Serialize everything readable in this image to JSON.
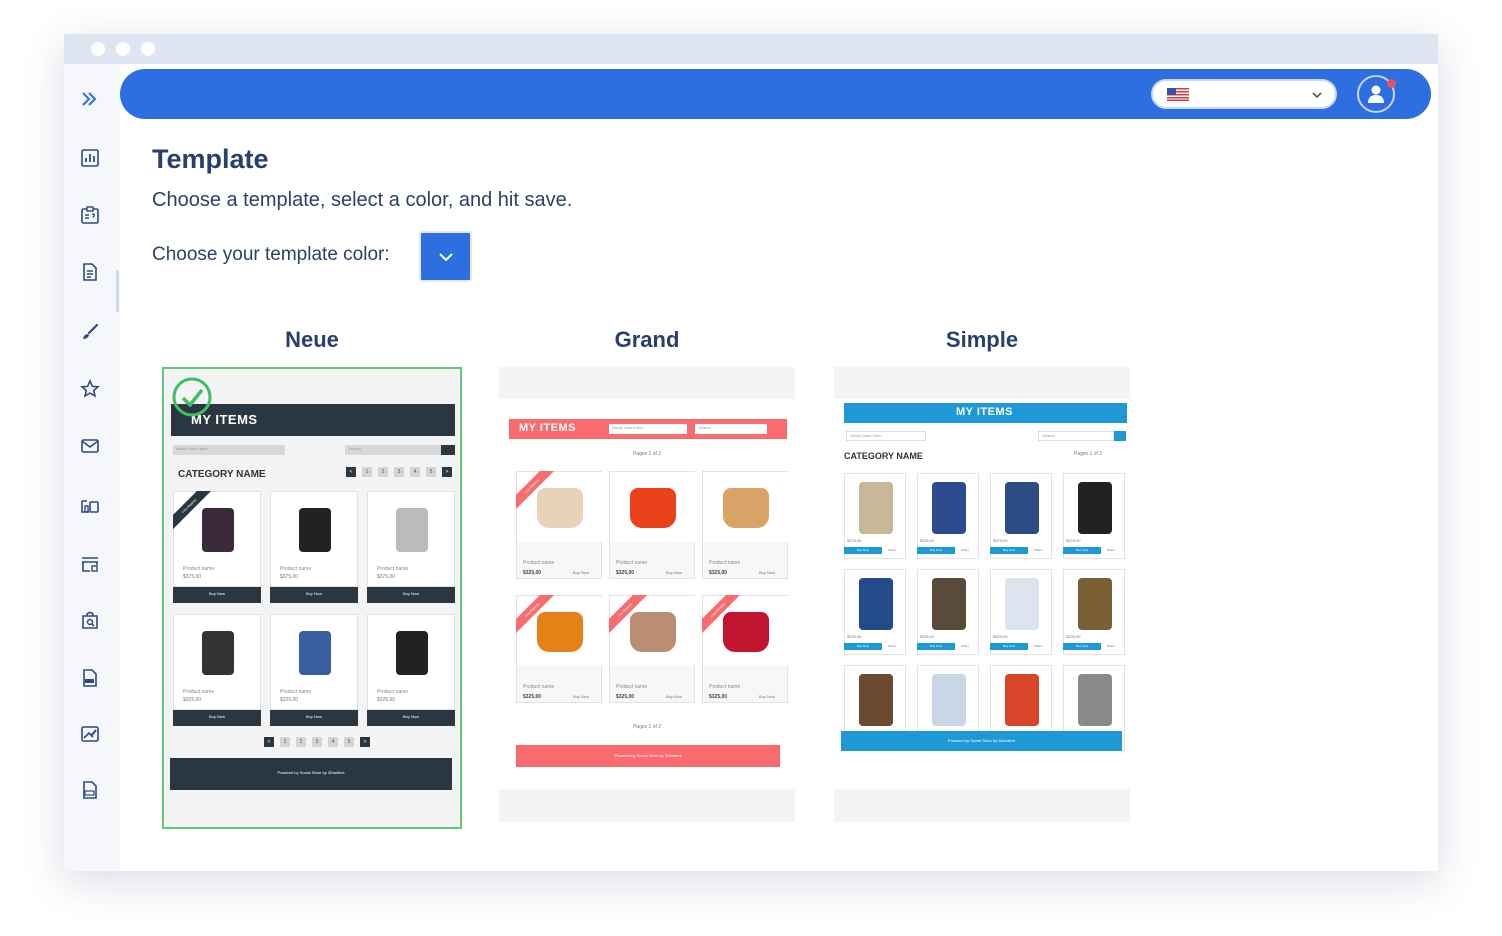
{
  "page": {
    "title": "Template",
    "subtitle": "Choose a template, select a color, and hit save.",
    "color_label": "Choose your template color:"
  },
  "header": {
    "language_icon": "us-flag-icon",
    "selected_language": "",
    "accent_color": "#2d6fe0",
    "notification_color": "#ef4f5c"
  },
  "sidebar": {
    "items": [
      {
        "icon": "expand-double-chevron-icon"
      },
      {
        "icon": "bar-chart-icon"
      },
      {
        "icon": "clipboard-question-icon"
      },
      {
        "icon": "document-icon"
      },
      {
        "icon": "brush-icon"
      },
      {
        "icon": "star-icon"
      },
      {
        "icon": "mail-icon"
      },
      {
        "icon": "devices-icon"
      },
      {
        "icon": "store-icon"
      },
      {
        "icon": "bag-search-icon"
      },
      {
        "icon": "pdf-file-icon"
      },
      {
        "icon": "image-edit-icon"
      },
      {
        "icon": "csv-file-icon"
      }
    ]
  },
  "templates": [
    {
      "name": "Neue",
      "selected": true,
      "preview": {
        "title": "MY ITEMS",
        "filter": "Newly Listed Item",
        "search": "Search",
        "category": "CATEGORY NAME",
        "products": [
          {
            "name": "Product name",
            "price": "$375,00",
            "buy": "Buy Now"
          },
          {
            "name": "Product name",
            "price": "$375,00",
            "buy": "Buy Now"
          },
          {
            "name": "Product name",
            "price": "$375,00",
            "buy": "Buy Now"
          },
          {
            "name": "Product name",
            "price": "$325,00",
            "buy": "Buy Now"
          },
          {
            "name": "Product name",
            "price": "$325,00",
            "buy": "Buy Now"
          },
          {
            "name": "Product name",
            "price": "$325,00",
            "buy": "Buy Now"
          }
        ],
        "ribbon": "Free Shipping",
        "pages": [
          "<",
          "1",
          "2",
          "3",
          "4",
          "5",
          ">"
        ],
        "footer": "Powered by Social Store by 3Dsellers",
        "color": "#2b3740"
      }
    },
    {
      "name": "Grand",
      "selected": false,
      "preview": {
        "title": "MY ITEMS",
        "filter": "Newly Listed Item",
        "search": "Search",
        "pages_label": "Pages 1 of 2",
        "products": [
          {
            "name": "Product name",
            "price": "$325,00",
            "buy": "Buy Now"
          },
          {
            "name": "Product name",
            "price": "$325,00",
            "buy": "Buy Now"
          },
          {
            "name": "Product name",
            "price": "$325,00",
            "buy": "Buy Now"
          },
          {
            "name": "Product name",
            "price": "$325,00",
            "buy": "Buy Now"
          },
          {
            "name": "Product name",
            "price": "$325,00",
            "buy": "Buy Now"
          },
          {
            "name": "Product name",
            "price": "$325,00",
            "buy": "Buy Now"
          }
        ],
        "ribbon": "Free Shipping",
        "footer": "Powered by Social Store by 3Dsellers",
        "color": "#f86b6f"
      }
    },
    {
      "name": "Simple",
      "selected": false,
      "preview": {
        "title": "MY ITEMS",
        "filter": "Newly Listed Item",
        "search": "Search",
        "category": "CATEGORY NAME",
        "pages_label": "Pages 1 of 2",
        "products": [
          {
            "price": "$375,00",
            "buy": "Buy Now",
            "share": "Share"
          },
          {
            "price": "$325,00",
            "buy": "Buy Now",
            "share": "Share"
          },
          {
            "price": "$375,00",
            "buy": "Buy Now",
            "share": "Share"
          },
          {
            "price": "$375,00",
            "buy": "Buy Now",
            "share": "Share"
          },
          {
            "price": "$325,00",
            "buy": "Buy Now",
            "share": "Share"
          },
          {
            "price": "$325,00",
            "buy": "Buy Now",
            "share": "Share"
          },
          {
            "price": "$325,00",
            "buy": "Buy Now",
            "share": "Share"
          },
          {
            "price": "$325,00",
            "buy": "Buy Now",
            "share": "Share"
          },
          {
            "price": "$325,00",
            "buy": "Buy Now",
            "share": "Share"
          },
          {
            "price": "$325,00",
            "buy": "Buy Now",
            "share": "Share"
          },
          {
            "price": "$325,00",
            "buy": "Buy Now",
            "share": "Share"
          },
          {
            "price": "$325,00",
            "buy": "Buy Now",
            "share": "Share"
          }
        ],
        "footer": "Powered by Social Store by 3Dsellers",
        "color": "#1f98d6"
      }
    }
  ]
}
